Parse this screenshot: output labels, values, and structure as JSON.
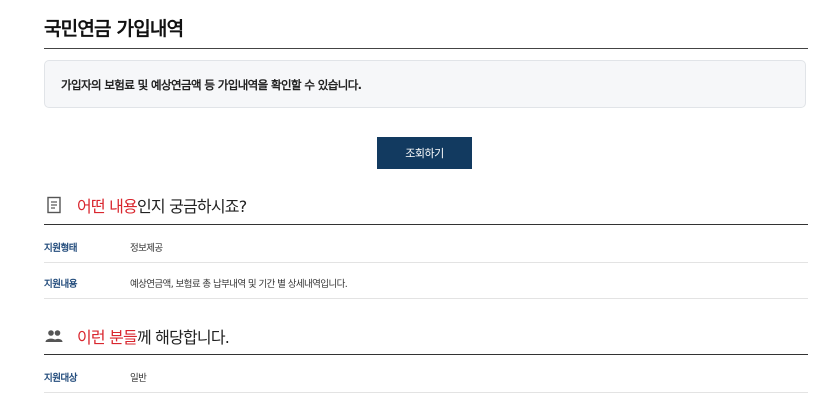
{
  "page": {
    "title": "국민연금 가입내역",
    "notice": "가입자의 보험료 및 예상연금액 등 가입내역을 확인할 수 있습니다.",
    "query_button": "조회하기"
  },
  "section_what": {
    "icon": "document-icon",
    "title_highlight": "어떤 내용",
    "title_rest": "인지 궁금하시죠?",
    "rows": [
      {
        "label": "지원형태",
        "value": "정보제공"
      },
      {
        "label": "지원내용",
        "value": "예상연금액, 보험료 총 납부내역 및 기간 별 상세내역입니다."
      }
    ]
  },
  "section_who": {
    "icon": "people-icon",
    "title_highlight": "이런 분들",
    "title_rest": "께 해당합니다.",
    "rows": [
      {
        "label": "지원대상",
        "value": "일반"
      }
    ]
  },
  "colors": {
    "accent_navy": "#123a60",
    "highlight_red": "#d9262e",
    "label_blue": "#234c7c"
  }
}
